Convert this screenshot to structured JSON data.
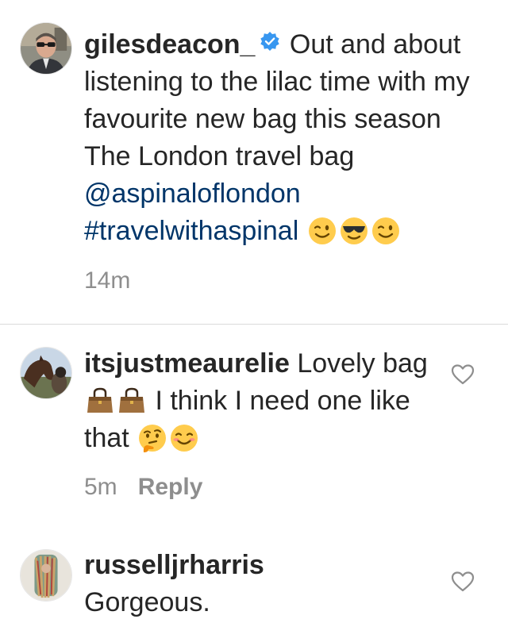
{
  "caption": {
    "username": "giles_deacon_verified",
    "username_text": "gilesdeacon_",
    "verified_icon": "verified-badge-icon",
    "text": "Out and about listening to the lilac time with my favourite new bag this season The London travel bag",
    "mention": "@aspinaloflondon",
    "hashtag": "#travelwithaspinal",
    "emojis": [
      "winking-face-icon",
      "smiling-face-with-sunglasses-icon",
      "winking-face-icon"
    ],
    "timestamp": "14m"
  },
  "comments": [
    {
      "username": "itsjustmeaurelie",
      "text_part1": "Lovely bag",
      "emojis_mid": [
        "handbag-icon",
        "handbag-icon"
      ],
      "text_part2": "I think I need one like that",
      "emojis_end": [
        "thinking-face-icon",
        "smiling-face-icon"
      ],
      "timestamp": "5m",
      "reply_label": "Reply"
    },
    {
      "username": "russelljrharris",
      "text": "Gorgeous."
    }
  ],
  "colors": {
    "text": "#262626",
    "link": "#003569",
    "muted": "#8e8e8e",
    "verified": "#3897f0",
    "divider": "#dbdbdb"
  }
}
